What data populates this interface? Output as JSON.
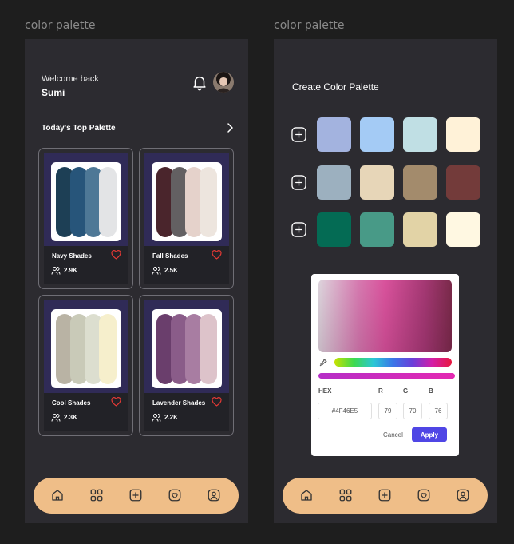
{
  "frames": {
    "left_label": "color palette",
    "right_label": "color palette"
  },
  "home": {
    "welcome": "Welcome back",
    "user": "Sumi",
    "section_title": "Today's Top Palette",
    "cards": [
      {
        "name": "Navy Shades",
        "count": "2.9K",
        "colors": [
          "#1d3f55",
          "#27557a",
          "#4e7896",
          "#e3e4e6"
        ]
      },
      {
        "name": "Fall Shades",
        "count": "2.5K",
        "colors": [
          "#4a252c",
          "#636062",
          "#e5d2cb",
          "#ede5de"
        ]
      },
      {
        "name": "Cool Shades",
        "count": "2.3K",
        "colors": [
          "#b9b3a4",
          "#c9cab8",
          "#dcdecf",
          "#f6efcc"
        ]
      },
      {
        "name": "Lavender Shades",
        "count": "2.2K",
        "colors": [
          "#6a3e6c",
          "#8a5c89",
          "#a87da2",
          "#ddc3ca"
        ]
      }
    ],
    "heart_color": "#e53935"
  },
  "create": {
    "title": "Create Color Palette",
    "rows": [
      [
        "#a3b3df",
        "#a4cbf5",
        "#c0dfe4",
        "#fff2d8"
      ],
      [
        "#9cb0bf",
        "#e7d6b8",
        "#a38b6c",
        "#733b3a"
      ],
      [
        "#046b54",
        "#489a87",
        "#e2d3a6",
        "#fff8e2"
      ]
    ]
  },
  "picker": {
    "hex_label": "HEX",
    "r_label": "R",
    "g_label": "G",
    "b_label": "B",
    "hex_value": "#4F46E5",
    "r": "79",
    "g": "70",
    "b": "76",
    "cancel": "Cancel",
    "apply": "Apply",
    "accent": "#4f46e5"
  },
  "nav": {
    "items": [
      "home-icon",
      "grid-icon",
      "add-square-icon",
      "heart-icon",
      "profile-icon"
    ],
    "bg": "#efbe88"
  }
}
